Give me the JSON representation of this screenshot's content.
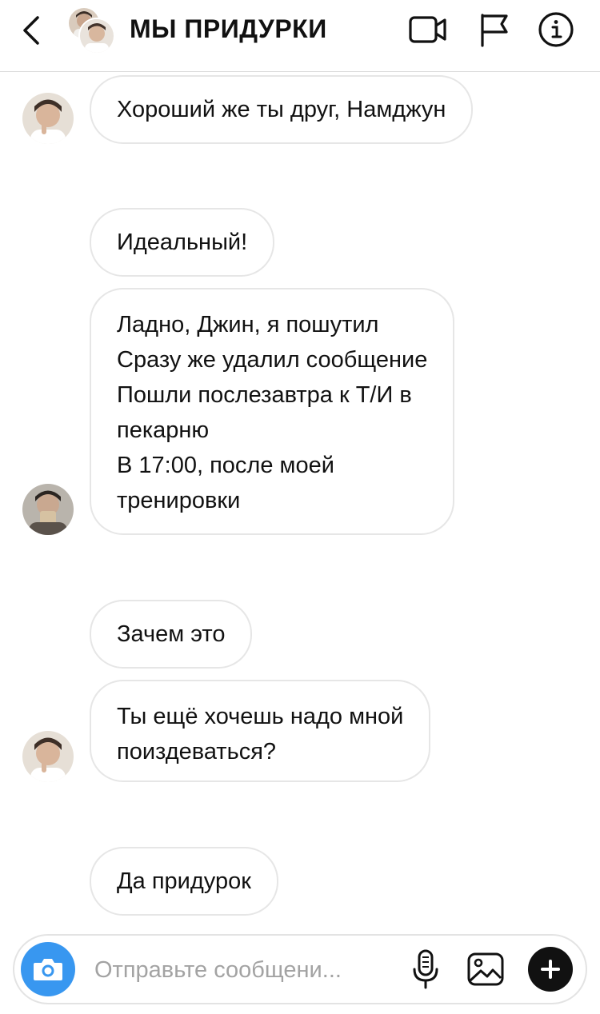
{
  "header": {
    "title": "МЫ ПРИДУРКИ",
    "icons": [
      "back-chevron-icon",
      "group-avatar",
      "video-call-icon",
      "flag-icon",
      "info-icon"
    ]
  },
  "messages": [
    {
      "sender_avatar": true,
      "lines": [
        "Хороший же ты друг, Намджун"
      ]
    },
    {
      "sender_avatar": false,
      "lines": [
        "Идеальный!"
      ]
    },
    {
      "sender_avatar": true,
      "lines": [
        "Ладно, Джин, я пошутил",
        "Сразу же удалил сообщение",
        "Пошли послезавтра к Т/И в",
        "пекарню",
        "В 17:00, после моей",
        "тренировки"
      ]
    },
    {
      "sender_avatar": false,
      "lines": [
        "Зачем это"
      ]
    },
    {
      "sender_avatar": true,
      "lines": [
        "Ты ещё хочешь надо мной",
        "поиздеваться?"
      ]
    },
    {
      "sender_avatar": false,
      "lines": [
        "Да придурок"
      ]
    }
  ],
  "composer": {
    "placeholder": "Отправьте сообщени...",
    "value": "",
    "icons": [
      "camera-icon",
      "microphone-icon",
      "gallery-icon",
      "plus-icon"
    ]
  },
  "colors": {
    "accent": "#3897f0",
    "bubble_border": "#e6e6e6",
    "placeholder": "#a3a3a3"
  }
}
